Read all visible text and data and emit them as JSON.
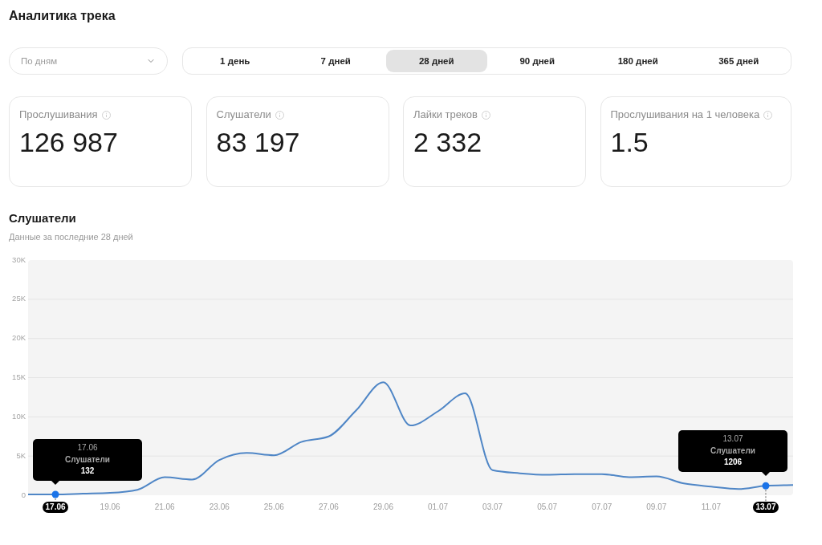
{
  "page": {
    "title": "Аналитика трека"
  },
  "controls": {
    "grouping": {
      "value": "По дням"
    },
    "periods": [
      {
        "label": "1 день",
        "selected": false
      },
      {
        "label": "7 дней",
        "selected": false
      },
      {
        "label": "28 дней",
        "selected": true
      },
      {
        "label": "90 дней",
        "selected": false
      },
      {
        "label": "180 дней",
        "selected": false
      },
      {
        "label": "365 дней",
        "selected": false
      }
    ]
  },
  "metrics": [
    {
      "label": "Прослушивания",
      "value": "126 987"
    },
    {
      "label": "Слушатели",
      "value": "83 197"
    },
    {
      "label": "Лайки треков",
      "value": "2 332"
    },
    {
      "label": "Прослушивания на 1 человека",
      "value": "1.5"
    }
  ],
  "listeners_chart": {
    "title": "Слушатели",
    "subtitle": "Данные за последние 28 дней",
    "chart_data": {
      "type": "line",
      "categories": [
        null,
        "17.06",
        null,
        "19.06",
        null,
        "21.06",
        null,
        "23.06",
        null,
        "25.06",
        null,
        "27.06",
        null,
        "29.06",
        null,
        "01.07",
        null,
        "03.07",
        null,
        "05.07",
        null,
        "07.07",
        null,
        "09.07",
        null,
        "11.07",
        null,
        "13.07",
        null
      ],
      "series": [
        {
          "color": "#4f86c6",
          "values": [
            100,
            100,
            200,
            300,
            700,
            2300,
            2000,
            4500,
            5400,
            5100,
            6800,
            7500,
            10800,
            14400,
            8900,
            10700,
            13000,
            3200,
            2800,
            2600,
            2700,
            2700,
            2300,
            2400,
            1500,
            1100,
            800,
            1200,
            1300
          ]
        }
      ],
      "ylim": [
        0,
        30000
      ],
      "grid": true,
      "yticks": [
        {
          "value": 0,
          "label": "0"
        },
        {
          "value": 5000,
          "label": "5K"
        },
        {
          "value": 10000,
          "label": "10K"
        },
        {
          "value": 15000,
          "label": "15K"
        },
        {
          "value": 20000,
          "label": "20K"
        },
        {
          "value": 25000,
          "label": "25K"
        },
        {
          "value": 30000,
          "label": "30K"
        }
      ]
    },
    "tooltips": [
      {
        "date": "17.06",
        "series_name": "Слушатели",
        "value": "132"
      },
      {
        "date": "13.07",
        "series_name": "Слушатели",
        "value": "1206"
      }
    ]
  }
}
